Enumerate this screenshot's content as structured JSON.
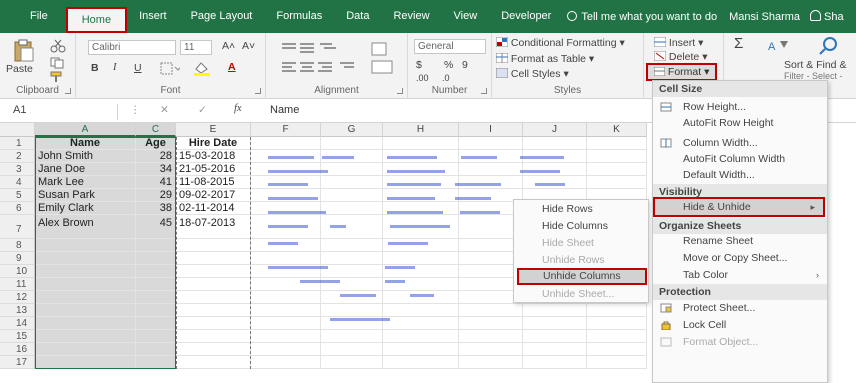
{
  "tabs": {
    "file": "File",
    "home": "Home",
    "insert": "Insert",
    "page_layout": "Page Layout",
    "formulas": "Formulas",
    "data": "Data",
    "review": "Review",
    "view": "View",
    "developer": "Developer",
    "tell_me": "Tell me what you want to do",
    "user": "Mansi Sharma",
    "share": "Sha"
  },
  "ribbon": {
    "clipboard": {
      "paste": "Paste",
      "label": "Clipboard"
    },
    "font": {
      "name": "Calibri",
      "size": "11",
      "grow": "A˄",
      "shrink": "A˅",
      "bold": "B",
      "italic": "I",
      "underline": "U",
      "font_color_glyph": "A",
      "label": "Font"
    },
    "alignment": {
      "label": "Alignment"
    },
    "number": {
      "format": "General",
      "currency": "$",
      "percent": "%",
      "comma": "9",
      "dec_inc": ".00",
      "dec_dec": ".0",
      "label": "Number"
    },
    "styles": {
      "conditional": "Conditional Formatting",
      "format_table": "Format as Table",
      "cell_styles": "Cell Styles",
      "label": "Styles"
    },
    "cells": {
      "insert": "Insert",
      "delete": "Delete",
      "format": "Format"
    },
    "editing": {
      "sum": "Σ",
      "sort_filter": "Sort & Find &",
      "filter": "Filter - Select -"
    }
  },
  "formula_bar": {
    "name_box": "A1",
    "fx": "fx",
    "content": "Name"
  },
  "grid": {
    "columns": [
      "A",
      "C",
      "E",
      "F",
      "G",
      "H",
      "I",
      "J",
      "K"
    ],
    "rows": [
      "1",
      "2",
      "3",
      "4",
      "5",
      "6",
      "7",
      "8",
      "9",
      "10",
      "11",
      "12",
      "13",
      "14",
      "15",
      "16",
      "17"
    ],
    "header": {
      "name": "Name",
      "age": "Age",
      "date": "Hire Date"
    },
    "records": [
      {
        "name": "John Smith",
        "age": "28",
        "date": "15-03-2018"
      },
      {
        "name": "Jane Doe",
        "age": "34",
        "date": "21-05-2016"
      },
      {
        "name": "Mark Lee",
        "age": "41",
        "date": "11-08-2015"
      },
      {
        "name": "Susan Park",
        "age": "29",
        "date": "09-02-2017"
      },
      {
        "name": "Emily Clark",
        "age": "38",
        "date": "02-11-2014"
      },
      {
        "name": "Alex Brown",
        "age": "45",
        "date": "18-07-2013"
      }
    ]
  },
  "context_menu": {
    "items": [
      "Hide Rows",
      "Hide Columns",
      "Hide Sheet",
      "Unhide Rows",
      "Unhide Columns",
      "Unhide Sheet..."
    ]
  },
  "format_menu": {
    "cell_size": "Cell Size",
    "row_height": "Row Height...",
    "autofit_row": "AutoFit Row Height",
    "column_width": "Column Width...",
    "autofit_column": "AutoFit Column Width",
    "default_width": "Default Width...",
    "visibility": "Visibility",
    "hide_unhide": "Hide & Unhide",
    "organize": "Organize Sheets",
    "rename": "Rename Sheet",
    "move_copy": "Move or Copy Sheet...",
    "tab_color": "Tab Color",
    "protection": "Protection",
    "protect_sheet": "Protect Sheet...",
    "lock_cell": "Lock Cell",
    "format_object": "Format Object..."
  },
  "colors": {
    "excel_green": "#217346",
    "highlight_red": "#c00000",
    "selected_gray": "#d9d9d9"
  }
}
